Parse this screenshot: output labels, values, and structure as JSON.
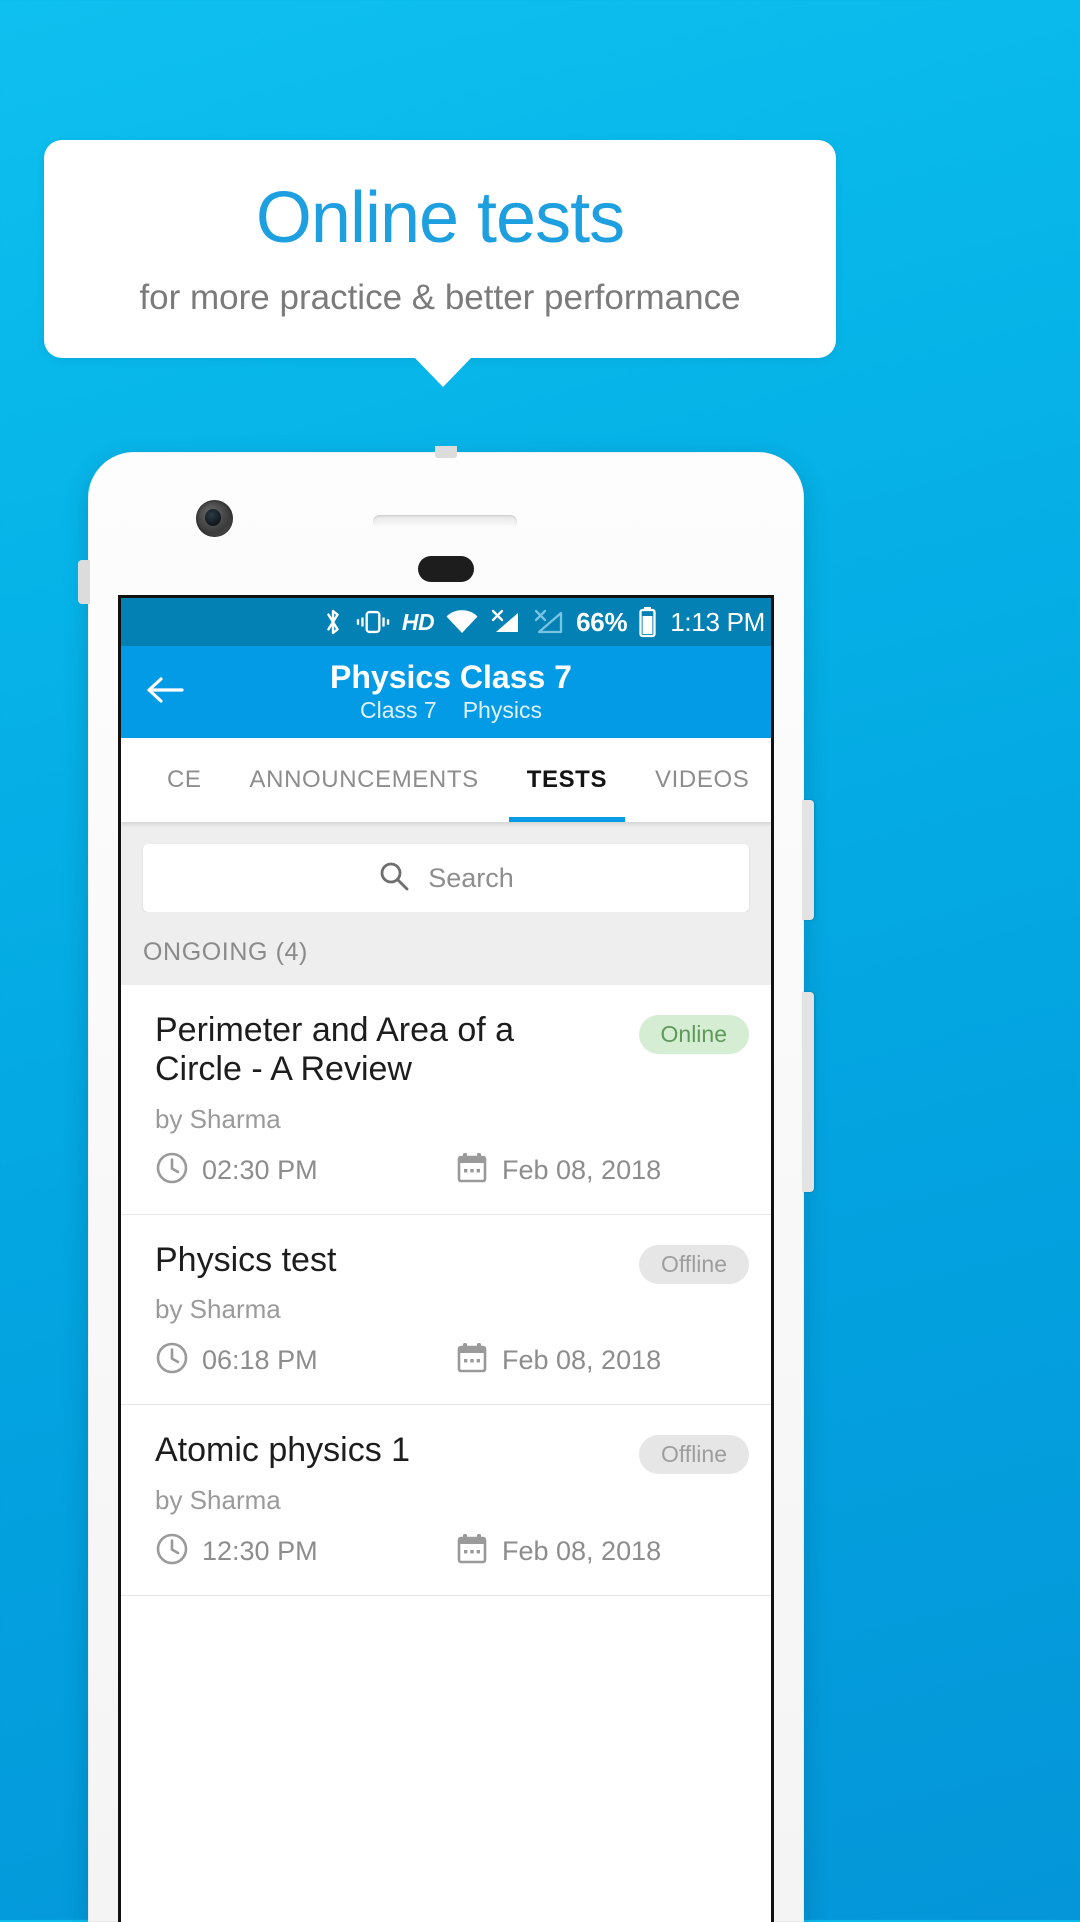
{
  "promo": {
    "title": "Online tests",
    "subtitle": "for more practice & better performance",
    "title_color": "#1e9fe0",
    "subtitle_color": "#7b7b7b",
    "background_color": "#06b3e8"
  },
  "statusbar": {
    "icons": [
      "bluetooth-icon",
      "vibrate-icon",
      "hd-icon",
      "wifi-icon",
      "signal-sim1-no-service-icon",
      "signal-sim2-no-service-icon",
      "battery-icon"
    ],
    "hd_label": "HD",
    "battery_percent": "66%",
    "time": "1:13 PM",
    "background_color": "#0381b4"
  },
  "appbar": {
    "back_icon": "arrow-left-icon",
    "title": "Physics Class 7",
    "subtitle_class": "Class 7",
    "subtitle_subject": "Physics",
    "background_color": "#039be5"
  },
  "tabs": {
    "items": [
      {
        "label": "CE",
        "active": false
      },
      {
        "label": "ANNOUNCEMENTS",
        "active": false
      },
      {
        "label": "TESTS",
        "active": true
      },
      {
        "label": "VIDEOS",
        "active": false
      }
    ],
    "indicator_color": "#039be5"
  },
  "search": {
    "icon": "search-icon",
    "placeholder": "Search",
    "value": ""
  },
  "section": {
    "label": "ONGOING (4)"
  },
  "tests": [
    {
      "title": "Perimeter and Area of a Circle - A Review",
      "author": "by Sharma",
      "time": "02:30 PM",
      "date": "Feb 08, 2018",
      "badge": "Online",
      "badge_type": "online"
    },
    {
      "title": "Physics test",
      "author": "by Sharma",
      "time": "06:18 PM",
      "date": "Feb 08, 2018",
      "badge": "Offline",
      "badge_type": "offline"
    },
    {
      "title": "Atomic physics 1",
      "author": "by Sharma",
      "time": "12:30 PM",
      "date": "Feb 08, 2018",
      "badge": "Offline",
      "badge_type": "offline"
    }
  ],
  "icons": {
    "clock": "clock-icon",
    "calendar": "calendar-icon"
  }
}
